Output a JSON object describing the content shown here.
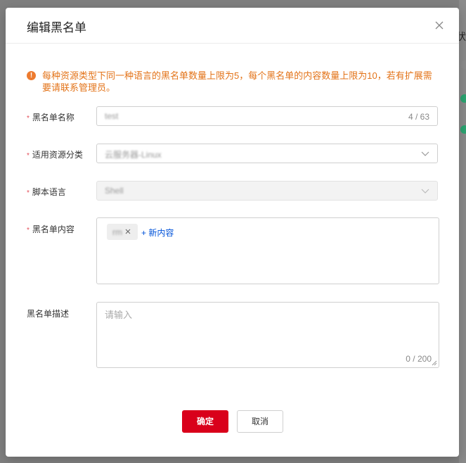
{
  "backdrop": {
    "edge_glyph": "状",
    "status_colors": [
      "#8c8c8c",
      "#2ba471",
      "#2ba471"
    ]
  },
  "dialog": {
    "title": "编辑黑名单",
    "notice": "每种资源类型下同一种语言的黑名单数量上限为5，每个黑名单的内容数量上限为10，若有扩展需要请联系管理员。",
    "notice_icon": "!"
  },
  "form": {
    "name": {
      "label": "黑名单名称",
      "value": "test",
      "counter": "4 / 63"
    },
    "category": {
      "label": "适用资源分类",
      "value": "云服务器-Linux"
    },
    "language": {
      "label": "脚本语言",
      "value": "Shell"
    },
    "content": {
      "label": "黑名单内容",
      "tag": "rm",
      "add_label": "+ 新内容"
    },
    "description": {
      "label": "黑名单描述",
      "placeholder": "请输入",
      "counter": "0 / 200"
    }
  },
  "footer": {
    "confirm": "确定",
    "cancel": "取消"
  },
  "colors": {
    "accent": "#d9001b",
    "link": "#0052d9",
    "warning": "#e37318",
    "required": "#e34d59"
  }
}
